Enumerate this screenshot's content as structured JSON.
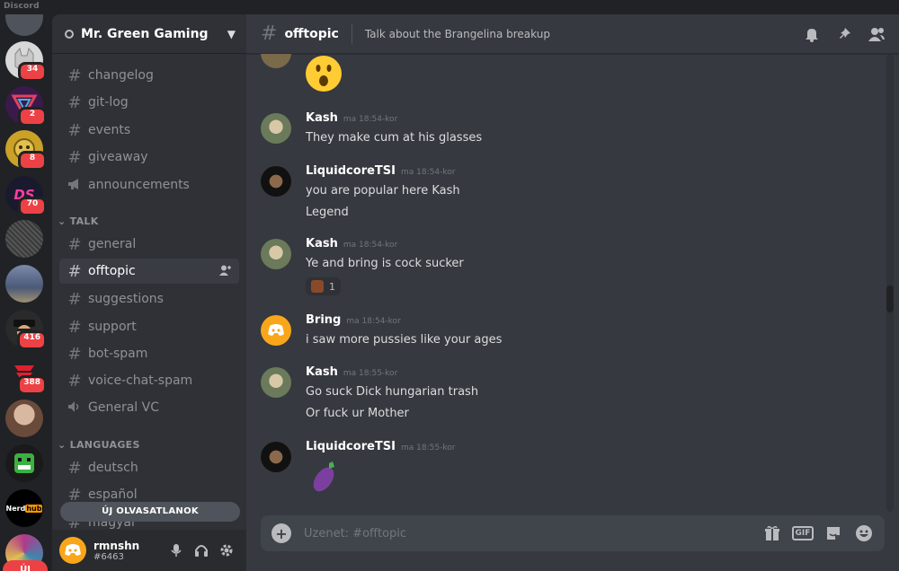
{
  "window": {
    "title": "Discord"
  },
  "servers": [
    {
      "name": "server-cat",
      "badge": "",
      "color": "#4f545c"
    },
    {
      "name": "server-cat-red",
      "badge": "34",
      "color": "#d8d8d8"
    },
    {
      "name": "server-triangle",
      "badge": "2",
      "color": "#3a1a4a"
    },
    {
      "name": "server-yellow",
      "badge": "8",
      "color": "#c9a227"
    },
    {
      "name": "server-ds",
      "badge": "70",
      "color": "#1a1a2e",
      "label": "DS"
    },
    {
      "name": "server-text-art",
      "badge": "",
      "color": "#3a3a3a"
    },
    {
      "name": "server-photo",
      "badge": "",
      "color": "#5a6a8a"
    },
    {
      "name": "server-hat",
      "badge": "416",
      "color": "#2a2a2a"
    },
    {
      "name": "server-red-logo",
      "badge": "388",
      "color": "#202225"
    },
    {
      "name": "server-portrait",
      "badge": "",
      "color": "#8a6a5a"
    },
    {
      "name": "server-green-face",
      "badge": "",
      "color": "#1a1a1a"
    },
    {
      "name": "server-nerdhub",
      "badge": "",
      "color": "#000000",
      "label": "Nerdhub"
    },
    {
      "name": "server-colorful",
      "badge": "",
      "color": "#b03a8a"
    }
  ],
  "new_pill": "ÚJ",
  "guild": {
    "name": "Mr. Green Gaming"
  },
  "channels": [
    {
      "label": "changelog",
      "type": "text"
    },
    {
      "label": "git-log",
      "type": "text"
    },
    {
      "label": "events",
      "type": "text"
    },
    {
      "label": "giveaway",
      "type": "text"
    },
    {
      "label": "announcements",
      "type": "announce"
    }
  ],
  "categories": {
    "talk": "TALK",
    "languages": "LANGUAGES"
  },
  "talk_channels": [
    {
      "label": "general",
      "type": "text"
    },
    {
      "label": "offtopic",
      "type": "text",
      "active": true
    },
    {
      "label": "suggestions",
      "type": "text"
    },
    {
      "label": "support",
      "type": "text"
    },
    {
      "label": "bot-spam",
      "type": "text"
    },
    {
      "label": "voice-chat-spam",
      "type": "text"
    },
    {
      "label": "General VC",
      "type": "voice"
    }
  ],
  "language_channels": [
    {
      "label": "deutsch",
      "type": "text"
    },
    {
      "label": "español",
      "type": "text"
    },
    {
      "label": "magyar",
      "type": "text"
    }
  ],
  "unread_pill": "ÚJ OLVASATLANOK",
  "user": {
    "name": "rmnshn",
    "tag": "#6463"
  },
  "header": {
    "channel": "offtopic",
    "topic": "Talk about the Brangelina breakup"
  },
  "messages": [
    {
      "author": "Kash",
      "time": "ma 18:54-kor",
      "lines": [
        "They make cum at his glasses"
      ]
    },
    {
      "author": "LiquidcoreTSI",
      "time": "ma 18:54-kor",
      "lines": [
        "you are popular here Kash",
        "Legend"
      ]
    },
    {
      "author": "Kash",
      "time": "ma 18:54-kor",
      "lines": [
        "Ye and bring is cock sucker"
      ],
      "reaction_count": "1"
    },
    {
      "author": "Bring",
      "time": "ma 18:54-kor",
      "lines": [
        "i saw more pussies like your ages"
      ]
    },
    {
      "author": "Kash",
      "time": "ma 18:55-kor",
      "lines": [
        "Go suck Dick hungarian trash",
        "Or fuck ur Mother"
      ]
    },
    {
      "author": "LiquidcoreTSI",
      "time": "ma 18:55-kor",
      "lines": []
    }
  ],
  "composer": {
    "placeholder": "Üzenet: #offtopic",
    "gif_label": "GIF"
  },
  "colors": {
    "accent": "#5865f2",
    "badge": "#ed4245",
    "bring_avatar": "#faa61a"
  }
}
